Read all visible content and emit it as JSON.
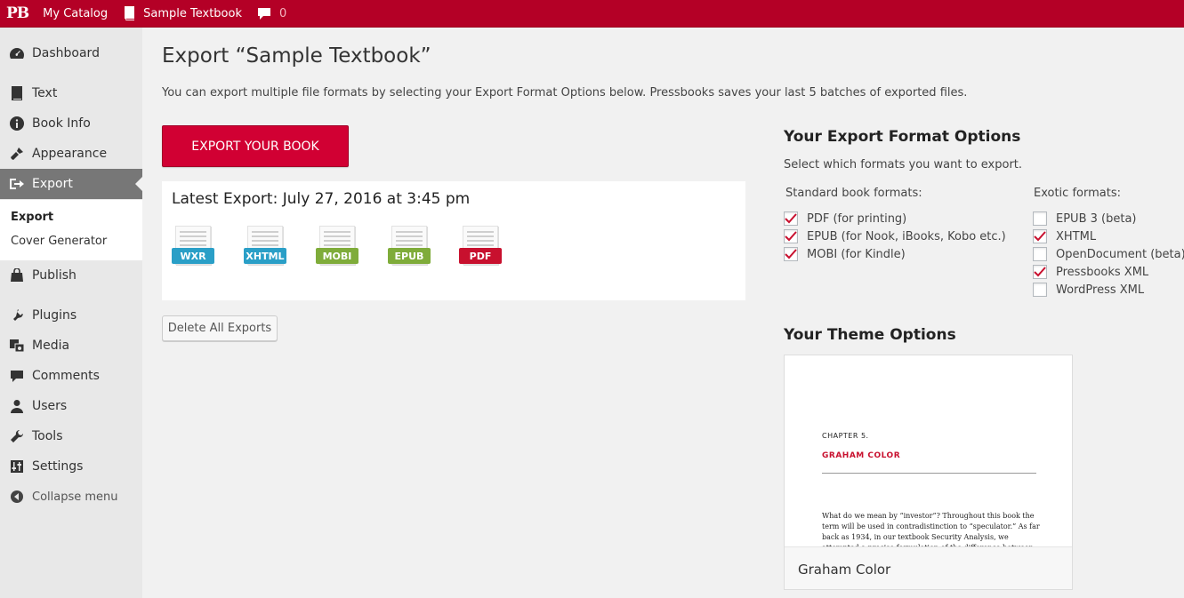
{
  "adminbar": {
    "logo": "PB",
    "catalog": "My Catalog",
    "book": "Sample Textbook",
    "comment_count": "0"
  },
  "sidebar": {
    "items": [
      {
        "label": "Dashboard",
        "icon": "dashboard-icon"
      },
      {
        "label": "Text",
        "icon": "book-icon"
      },
      {
        "label": "Book Info",
        "icon": "info-icon"
      },
      {
        "label": "Appearance",
        "icon": "brush-icon"
      },
      {
        "label": "Export",
        "icon": "export-icon"
      },
      {
        "label": "Publish",
        "icon": "store-icon"
      },
      {
        "label": "Plugins",
        "icon": "plug-icon"
      },
      {
        "label": "Media",
        "icon": "media-icon"
      },
      {
        "label": "Comments",
        "icon": "comment-icon"
      },
      {
        "label": "Users",
        "icon": "user-icon"
      },
      {
        "label": "Tools",
        "icon": "wrench-icon"
      },
      {
        "label": "Settings",
        "icon": "settings-icon"
      }
    ],
    "submenu": [
      "Export",
      "Cover Generator"
    ],
    "collapse": "Collapse menu"
  },
  "main": {
    "title": "Export “Sample Textbook”",
    "intro": "You can export multiple file formats by selecting your Export Format Options below. Pressbooks saves your last 5 batches of exported files.",
    "export_button": "Export Your Book",
    "latest_export": "Latest Export: July 27, 2016 at 3:45 pm",
    "files": [
      {
        "label": "WXR",
        "color": "#2a9fc7"
      },
      {
        "label": "XHTML",
        "color": "#2a9fc7"
      },
      {
        "label": "MOBI",
        "color": "#7fac3a"
      },
      {
        "label": "EPUB",
        "color": "#7fac3a"
      },
      {
        "label": "PDF",
        "color": "#c8102e"
      }
    ],
    "delete_button": "Delete All Exports"
  },
  "formats": {
    "title": "Your Export Format Options",
    "desc": "Select which formats you want to export.",
    "standard_label": "Standard book formats:",
    "exotic_label": "Exotic formats:",
    "standard": [
      {
        "label": "PDF (for printing)",
        "checked": true
      },
      {
        "label": "EPUB (for Nook, iBooks, Kobo etc.)",
        "checked": true
      },
      {
        "label": "MOBI (for Kindle)",
        "checked": true
      }
    ],
    "exotic": [
      {
        "label": "EPUB 3 (beta)",
        "checked": false
      },
      {
        "label": "XHTML",
        "checked": true
      },
      {
        "label": "OpenDocument (beta)",
        "checked": false
      },
      {
        "label": "Pressbooks XML",
        "checked": true
      },
      {
        "label": "WordPress XML",
        "checked": false
      }
    ]
  },
  "theme": {
    "title": "Your Theme Options",
    "chapter": "CHAPTER 5.",
    "chapter_title": "GRAHAM COLOR",
    "sample_text": "What do we mean by “investor”? Throughout this book the term will be used in contradistinction to “speculator.” As far back as 1934, in our textbook Security Analysis, we attempted a precise formulation of the difference between the two, as follows: “An",
    "name": "Graham Color"
  },
  "colors": {
    "brand": "#b40026",
    "button": "#d10033",
    "check": "#c8102e"
  }
}
